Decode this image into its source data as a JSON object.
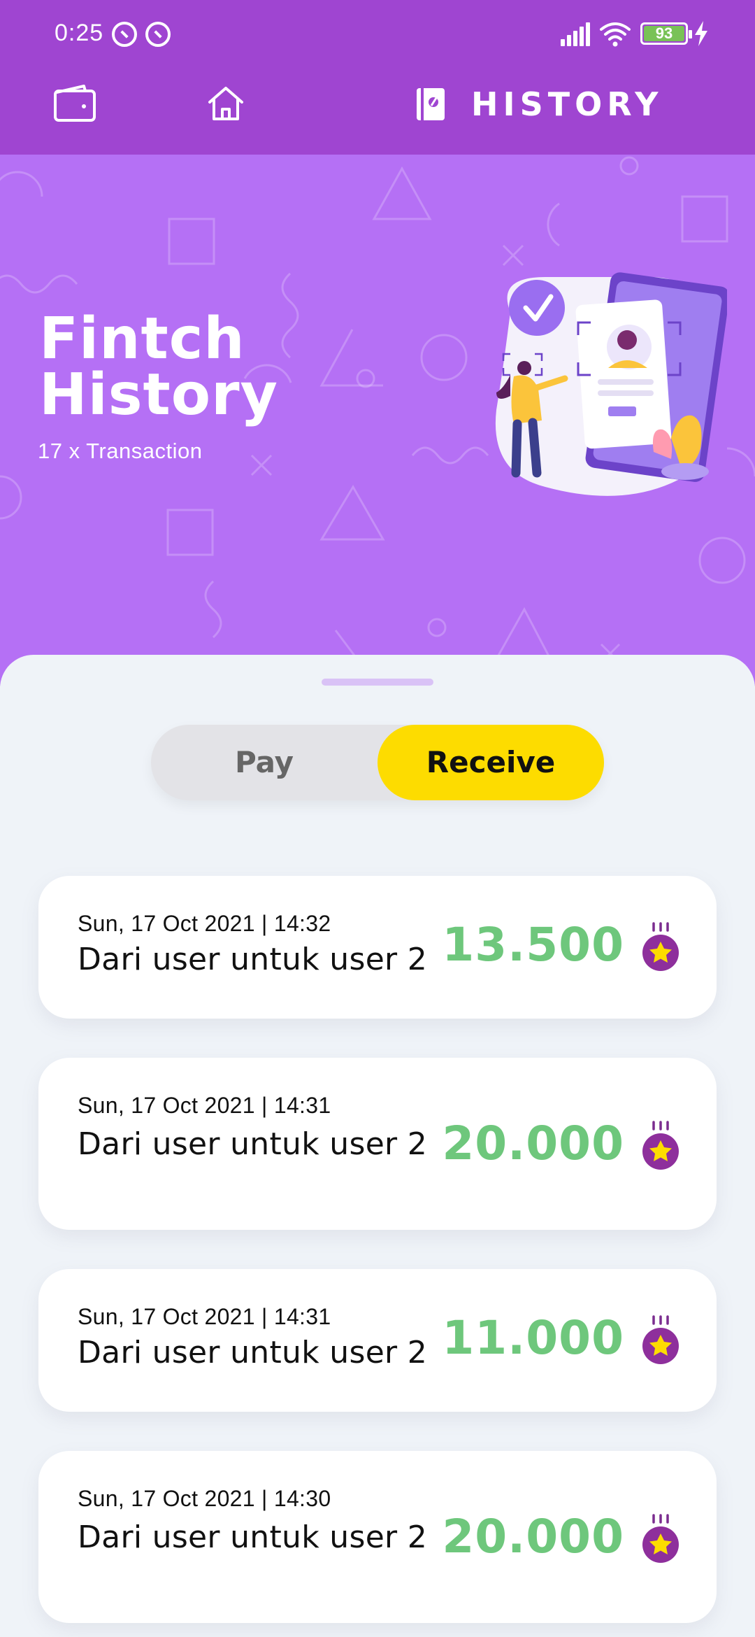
{
  "status_bar": {
    "time": "0:25",
    "battery": "93"
  },
  "nav": {
    "active_label": "HISTORY"
  },
  "hero": {
    "title_line1": "Fintch",
    "title_line2": "History",
    "subtitle": "17 x Transaction"
  },
  "toggle": {
    "pay_label": "Pay",
    "receive_label": "Receive",
    "active": "Receive"
  },
  "transactions": [
    {
      "date": "Sun, 17 Oct 2021 | 14:32",
      "description": "Dari user untuk user 2",
      "amount": "13.500"
    },
    {
      "date": "Sun, 17 Oct 2021 | 14:31",
      "description": "Dari user untuk user 2",
      "amount": "20.000"
    },
    {
      "date": "Sun, 17 Oct 2021 | 14:31",
      "description": "Dari user untuk user 2",
      "amount": "11.000"
    },
    {
      "date": "Sun, 17 Oct 2021 | 14:30",
      "description": "Dari user untuk user 2",
      "amount": "20.000"
    }
  ],
  "colors": {
    "topbar": "#9f45d1",
    "hero": "#b570f5",
    "accent_yellow": "#fddc00",
    "amount_green": "#6ec77c",
    "background": "#eff3f8"
  }
}
